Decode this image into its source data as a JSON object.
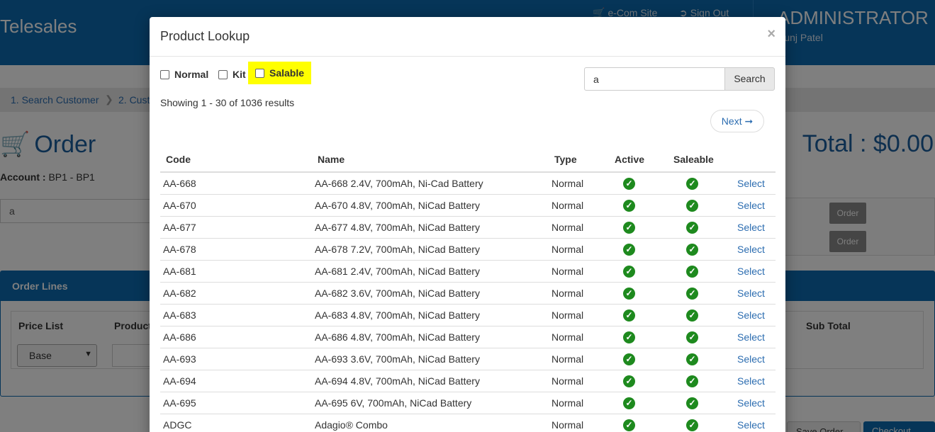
{
  "app": {
    "brand": "Telesales",
    "ecom_link": "e-Com Site",
    "signout_link": "Sign Out",
    "admin_title": "ADMINISTRATOR",
    "admin_user": "Kunj Patel"
  },
  "breadcrumb": {
    "step1": "1. Search Customer",
    "step2": "2. Cust"
  },
  "order": {
    "title": "Order",
    "total": "Total : $0.00",
    "account_label": "Account :",
    "account_value": "BP1 - BP1",
    "search_value": "a",
    "order_button": "Order"
  },
  "order_lines": {
    "title": "Order Lines",
    "price_list_header": "Price List",
    "product_header": "Product",
    "sub_total_header": "Sub Total",
    "price_list_value": "Base"
  },
  "footer": {
    "save_order": "Save Order",
    "checkout": "Checkout"
  },
  "modal": {
    "title": "Product Lookup",
    "close": "×",
    "filters": {
      "normal": "Normal",
      "kit": "Kit",
      "salable": "Salable"
    },
    "search_value": "a",
    "search_button": "Search",
    "results_text": "Showing 1 - 30 of 1036 results",
    "next_button": "Next ➞",
    "columns": {
      "code": "Code",
      "name": "Name",
      "type": "Type",
      "active": "Active",
      "saleable": "Saleable"
    },
    "select_label": "Select",
    "rows": [
      {
        "code": "AA-668",
        "name": "AA-668 2.4V, 700mAh, Ni-Cad Battery",
        "type": "Normal"
      },
      {
        "code": "AA-670",
        "name": "AA-670 4.8V, 700mAh, NiCad Battery",
        "type": "Normal"
      },
      {
        "code": "AA-677",
        "name": "AA-677 4.8V, 700mAh, NiCad Battery",
        "type": "Normal"
      },
      {
        "code": "AA-678",
        "name": "AA-678 7.2V, 700mAh, NiCad Battery",
        "type": "Normal"
      },
      {
        "code": "AA-681",
        "name": "AA-681 2.4V, 700mAh, NiCad Battery",
        "type": "Normal"
      },
      {
        "code": "AA-682",
        "name": "AA-682 3.6V, 700mAh, NiCad Battery",
        "type": "Normal"
      },
      {
        "code": "AA-683",
        "name": "AA-683 4.8V, 700mAh, NiCad Battery",
        "type": "Normal"
      },
      {
        "code": "AA-686",
        "name": "AA-686 4.8V, 700mAh, NiCad Battery",
        "type": "Normal"
      },
      {
        "code": "AA-693",
        "name": "AA-693 3.6V, 700mAh, NiCad Battery",
        "type": "Normal"
      },
      {
        "code": "AA-694",
        "name": "AA-694 4.8V, 700mAh, NiCad Battery",
        "type": "Normal"
      },
      {
        "code": "AA-695",
        "name": "AA-695 6V, 700mAh, NiCad Battery",
        "type": "Normal"
      },
      {
        "code": "ADGC",
        "name": "Adagio® Combo",
        "type": "Normal"
      }
    ]
  }
}
